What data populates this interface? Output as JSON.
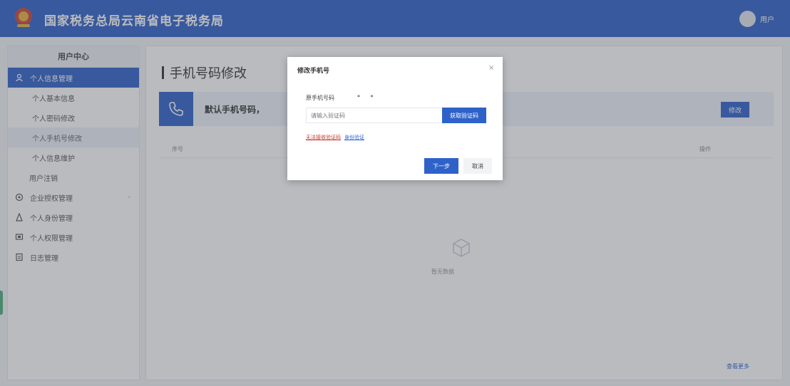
{
  "header": {
    "site_title": "国家税务总局云南省电子税务局",
    "username": "用户"
  },
  "sidebar": {
    "heading": "用户中心",
    "items": [
      {
        "label": "个人信息管理",
        "icon": "person-icon"
      },
      {
        "label": "个人基本信息"
      },
      {
        "label": "个人密码修改"
      },
      {
        "label": "个人手机号修改"
      },
      {
        "label": "个人信息维护"
      },
      {
        "label": "用户注销"
      },
      {
        "label": "企业授权管理",
        "icon": "gear-icon"
      },
      {
        "label": "个人身份管理",
        "icon": "user-icon"
      },
      {
        "label": "个人权限管理",
        "icon": "key-icon"
      },
      {
        "label": "日志管理",
        "icon": "document-icon"
      }
    ]
  },
  "main": {
    "page_title": "手机号码修改",
    "phone_text": "默认手机号码，",
    "modify_label": "修改",
    "col_left": "序号",
    "col_right": "操作",
    "empty_text": "暂无数据",
    "footer_link": "查看更多"
  },
  "modal": {
    "title": "修改手机号",
    "close": "×",
    "field_label": "原手机号码",
    "field_note": "*  *",
    "input_placeholder": "请输入验证码",
    "code_button": "获取验证码",
    "link_red": "无法接收验证码",
    "link_blue": "身份验证",
    "next_button": "下一步",
    "cancel_button": "取消"
  },
  "colors": {
    "primary": "#2f62c9",
    "accent_red": "#c0392b",
    "sidebar_hover": "#eef1f7"
  }
}
